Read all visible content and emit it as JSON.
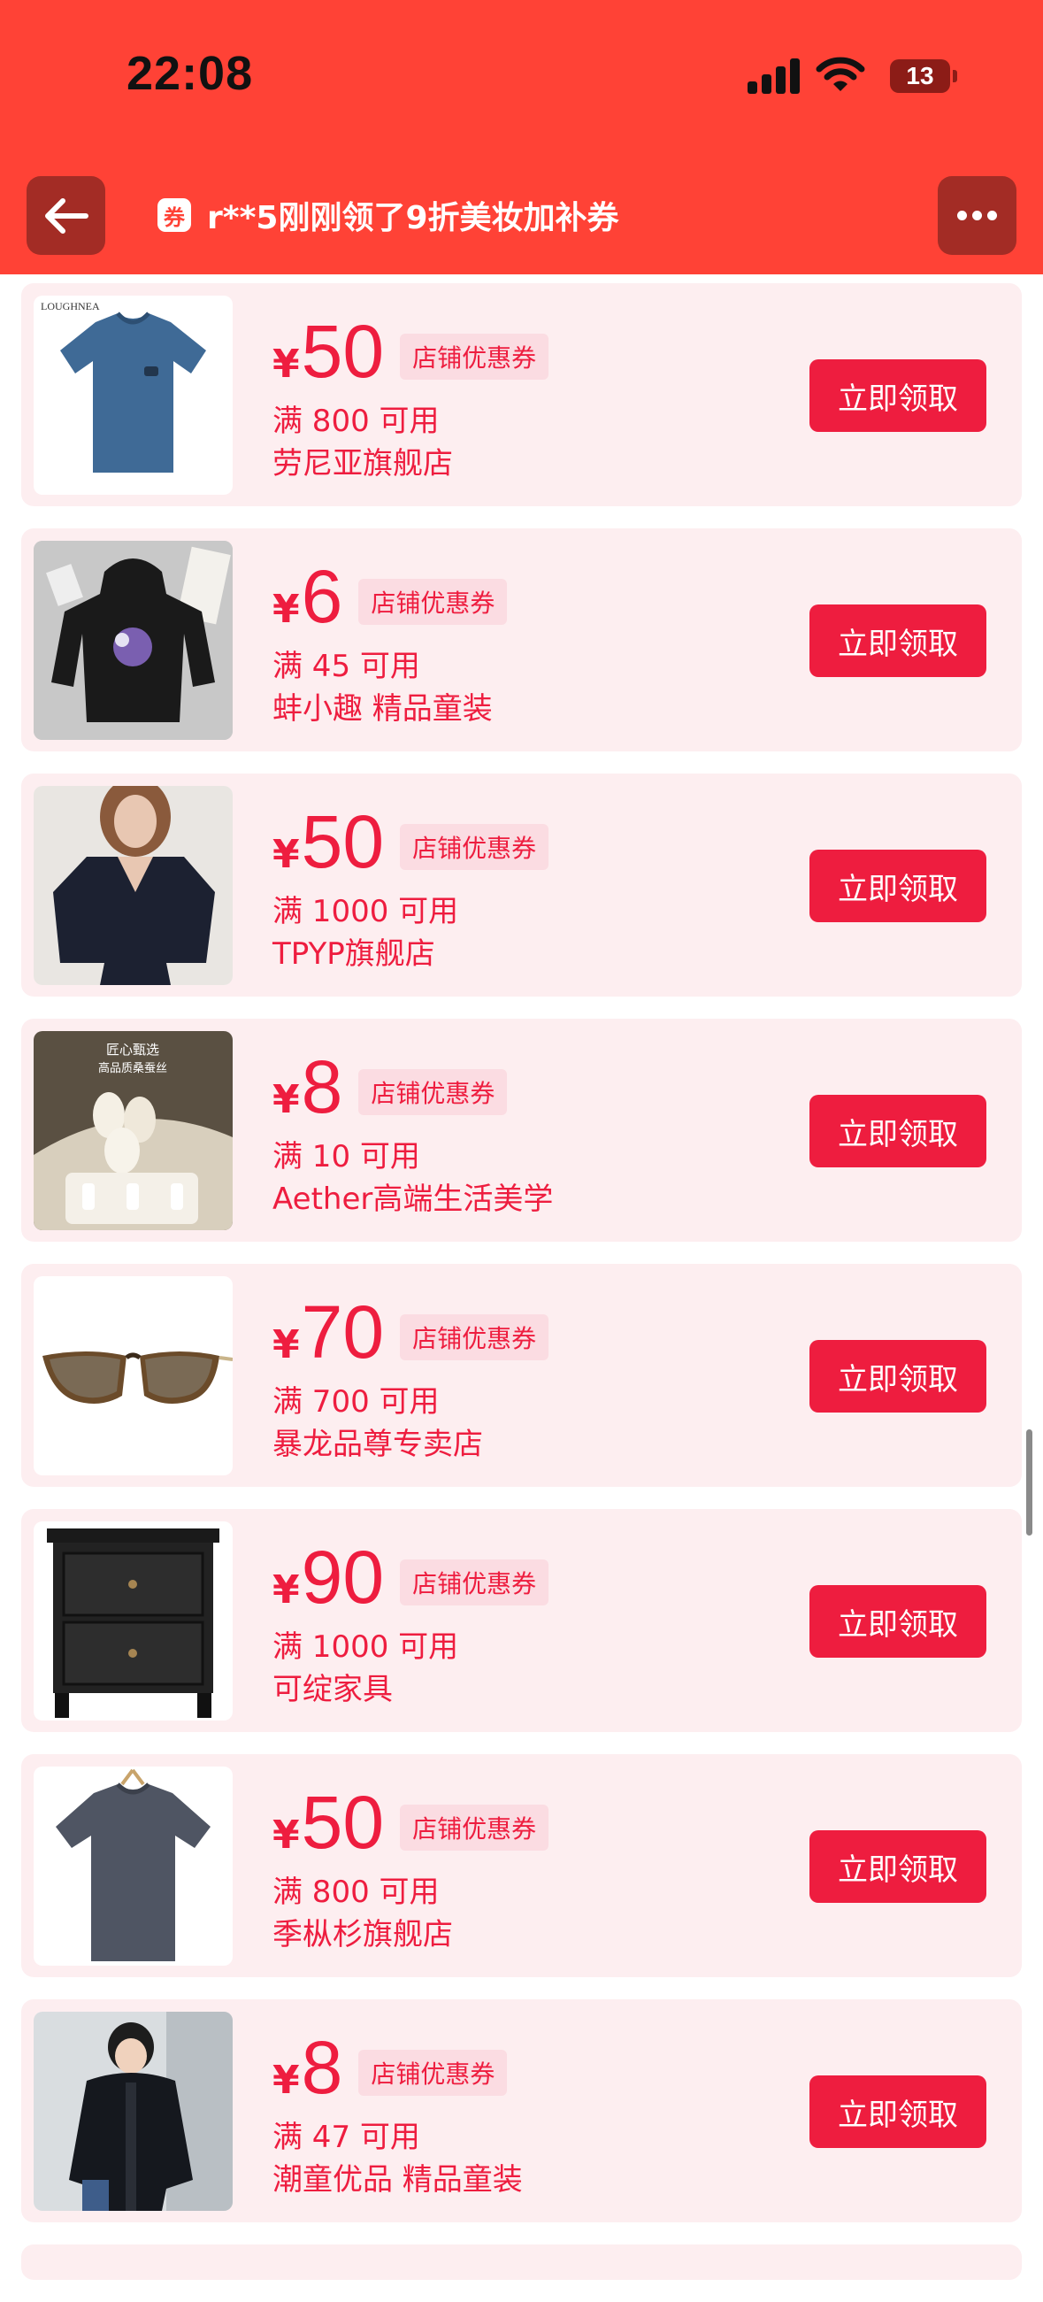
{
  "status_bar": {
    "time": "22:08",
    "battery": "13"
  },
  "header": {
    "ticker_icon": "券",
    "ticker_text": "r**5刚刚领了9折美妆加补券"
  },
  "coupons": [
    {
      "yen": "¥",
      "amount": "50",
      "tag": "店铺优惠券",
      "condition": "满 800 可用",
      "store": "劳尼亚旗舰店",
      "button": "立即领取",
      "thumb_brand": "LOUGHNEA"
    },
    {
      "yen": "¥",
      "amount": "6",
      "tag": "店铺优惠券",
      "condition": "满 45 可用",
      "store": "蚌小趣 精品童装",
      "button": "立即领取"
    },
    {
      "yen": "¥",
      "amount": "50",
      "tag": "店铺优惠券",
      "condition": "满 1000 可用",
      "store": "TPYP旗舰店",
      "button": "立即领取"
    },
    {
      "yen": "¥",
      "amount": "8",
      "tag": "店铺优惠券",
      "condition": "满 10 可用",
      "store": "Aether高端生活美学",
      "button": "立即领取",
      "thumb_text_1": "匠心甄选",
      "thumb_text_2": "高品质桑蚕丝"
    },
    {
      "yen": "¥",
      "amount": "70",
      "tag": "店铺优惠券",
      "condition": "满 700 可用",
      "store": "暴龙品尊专卖店",
      "button": "立即领取"
    },
    {
      "yen": "¥",
      "amount": "90",
      "tag": "店铺优惠券",
      "condition": "满 1000 可用",
      "store": "可绽家具",
      "button": "立即领取"
    },
    {
      "yen": "¥",
      "amount": "50",
      "tag": "店铺优惠券",
      "condition": "满 800 可用",
      "store": "季枞杉旗舰店",
      "button": "立即领取"
    },
    {
      "yen": "¥",
      "amount": "8",
      "tag": "店铺优惠券",
      "condition": "满 47 可用",
      "store": "潮童优品 精品童装",
      "button": "立即领取"
    }
  ],
  "colors": {
    "header": "#ff4236",
    "accent": "#ee1d3f",
    "card_bg": "#fdeef0"
  },
  "icons": {
    "back": "arrow-left-icon",
    "more": "more-dots-icon",
    "ticker": "coupon-icon"
  }
}
